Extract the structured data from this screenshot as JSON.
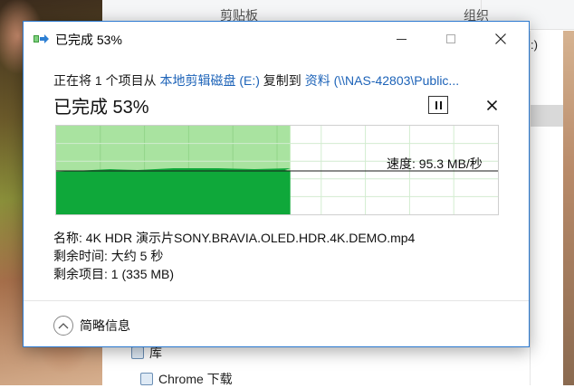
{
  "background": {
    "ribbon_groups": [
      "剪贴板",
      "组织"
    ],
    "right_text": ":)",
    "nav_items": [
      "库",
      "Chrome 下载"
    ]
  },
  "dialog": {
    "title": "已完成 53%",
    "progress_percent": 53,
    "status": {
      "prefix": "正在将 1 个项目从 ",
      "source": "本地剪辑磁盘 (E:)",
      "middle": " 复制到 ",
      "destination": "资料 (\\\\NAS-42803\\Public..."
    },
    "heading": "已完成 53%",
    "speed_text": "速度: 95.3 MB/秒",
    "info": {
      "name": "名称: 4K HDR 演示片SONY.BRAVIA.OLED.HDR.4K.DEMO.mp4",
      "time_left": "剩余时间: 大约 5 秒",
      "items_left": "剩余项目: 1 (335 MB)"
    },
    "details_label": "简略信息",
    "colors": {
      "progress_fill": "#a9e3a0",
      "speed_fill": "#0fa83a",
      "link": "#1d63b8",
      "accent_border": "#2b79d0"
    },
    "icons": [
      "copy-icon",
      "minimize-icon",
      "maximize-icon",
      "close-icon",
      "pause-icon",
      "cancel-icon",
      "chevron-up-icon"
    ]
  }
}
